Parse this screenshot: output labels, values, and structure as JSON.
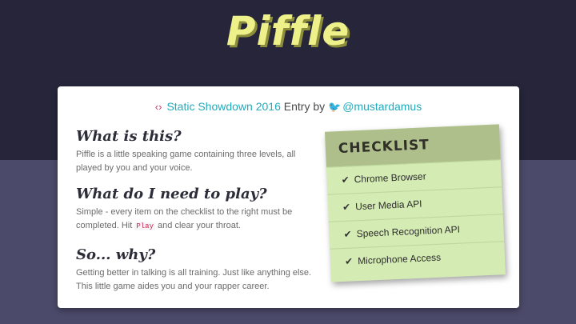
{
  "app": {
    "title": "Piffle"
  },
  "entry": {
    "event_link": "Static Showdown 2016",
    "middle_text": " Entry by ",
    "author_link": "@mustardamus",
    "event_icon": "static-showdown-icon",
    "author_icon": "twitter-icon"
  },
  "sections": [
    {
      "heading": "What is this?",
      "body": "Piffle is a little speaking game containing three levels, all played by you and your voice."
    },
    {
      "heading": "What do I need to play?",
      "body_before": "Simple - every item on the checklist to the right must be completed. Hit ",
      "code": "Play",
      "body_after": " and clear your throat."
    },
    {
      "heading": "So... why?",
      "body": "Getting better in talking is all training. Just like anything else. This little game aides you and your rapper career."
    }
  ],
  "checklist": {
    "title": "CHECKLIST",
    "items": [
      "Chrome Browser",
      "User Media API",
      "Speech Recognition API",
      "Microphone Access"
    ]
  },
  "colors": {
    "top_bg": "#26253a",
    "bottom_bg": "#4b4a6a",
    "logo": "#eef08a",
    "link": "#22aabb",
    "checklist_bg": "#d4ebb4",
    "checklist_header": "#aebf8c"
  }
}
